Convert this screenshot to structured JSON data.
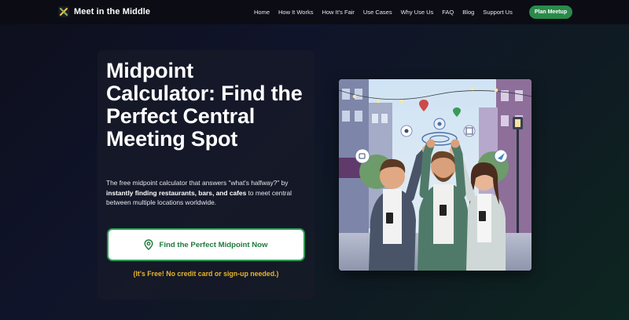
{
  "brand": {
    "name": "Meet in the Middle",
    "logo_icon": "crossed-arrows-logo-icon"
  },
  "nav": {
    "links": [
      "Home",
      "How It Works",
      "How It's Fair",
      "Use Cases",
      "Why Use Us",
      "FAQ",
      "Blog",
      "Support Us"
    ],
    "cta_label": "Plan Meetup"
  },
  "hero": {
    "title": "Midpoint Calculator: Find the Perfect Central Meeting Spot",
    "desc_prefix": "The free midpoint calculator that answers \"what's halfway?\" by ",
    "desc_bold": "instantly finding restaurants, bars, and cafes",
    "desc_suffix": " to meet central between multiple locations worldwide.",
    "cta_label": "Find the Perfect Midpoint Now",
    "cta_icon": "map-pin-icon",
    "free_note": "(It's Free! No credit card or sign-up needed.)"
  },
  "illustration": {
    "subject": "three friends high-fiving on a city street with map pins and icons above them",
    "icons": [
      "map-pin-icon",
      "coffee-icon",
      "calendar-icon",
      "send-icon",
      "location-target-icon",
      "people-icon"
    ]
  },
  "colors": {
    "accent_green": "#2a8a4a",
    "cta_border": "#2e9a55",
    "note_yellow": "#e8b42a",
    "background_dark": "#0d0f1c"
  }
}
